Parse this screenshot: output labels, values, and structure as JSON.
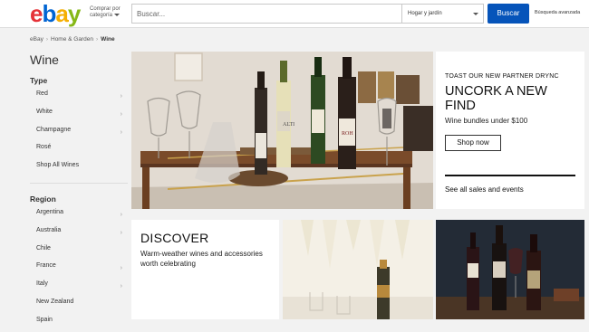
{
  "header": {
    "logo": {
      "e": "e",
      "b": "b",
      "a": "a",
      "y": "y"
    },
    "shop_by_category": {
      "line1": "Comprar por",
      "line2": "categoría"
    },
    "search_placeholder": "Buscar...",
    "category_select": "Hogar y jardín",
    "search_button": "Buscar",
    "advanced_search": "Búsqueda avanzada"
  },
  "breadcrumb": {
    "items": [
      "eBay",
      "Home & Garden"
    ],
    "current": "Wine"
  },
  "sidebar": {
    "title": "Wine",
    "type": {
      "heading": "Type",
      "items": [
        "Red",
        "White",
        "Champagne",
        "Rosé",
        "Shop All Wines"
      ]
    },
    "region": {
      "heading": "Region",
      "items": [
        "Argentina",
        "Australia",
        "Chile",
        "France",
        "Italy",
        "New Zealand",
        "Spain"
      ]
    }
  },
  "hero": {
    "kicker": "TOAST OUR NEW PARTNER DRYNC",
    "title": "UNCORK A NEW FIND",
    "subtitle": "Wine bundles under $100",
    "cta": "Shop now",
    "link": "See all sales and events",
    "labels": {
      "label_a": "ALTI",
      "label_b": "ROH"
    }
  },
  "discover": {
    "title": "DISCOVER",
    "subtitle": "Warm-weather wines and accessories worth celebrating"
  },
  "colors": {
    "accent": "#0654ba",
    "logo_e": "#e53238",
    "logo_b": "#0064d2",
    "logo_a": "#f5af02",
    "logo_y": "#86b817"
  }
}
